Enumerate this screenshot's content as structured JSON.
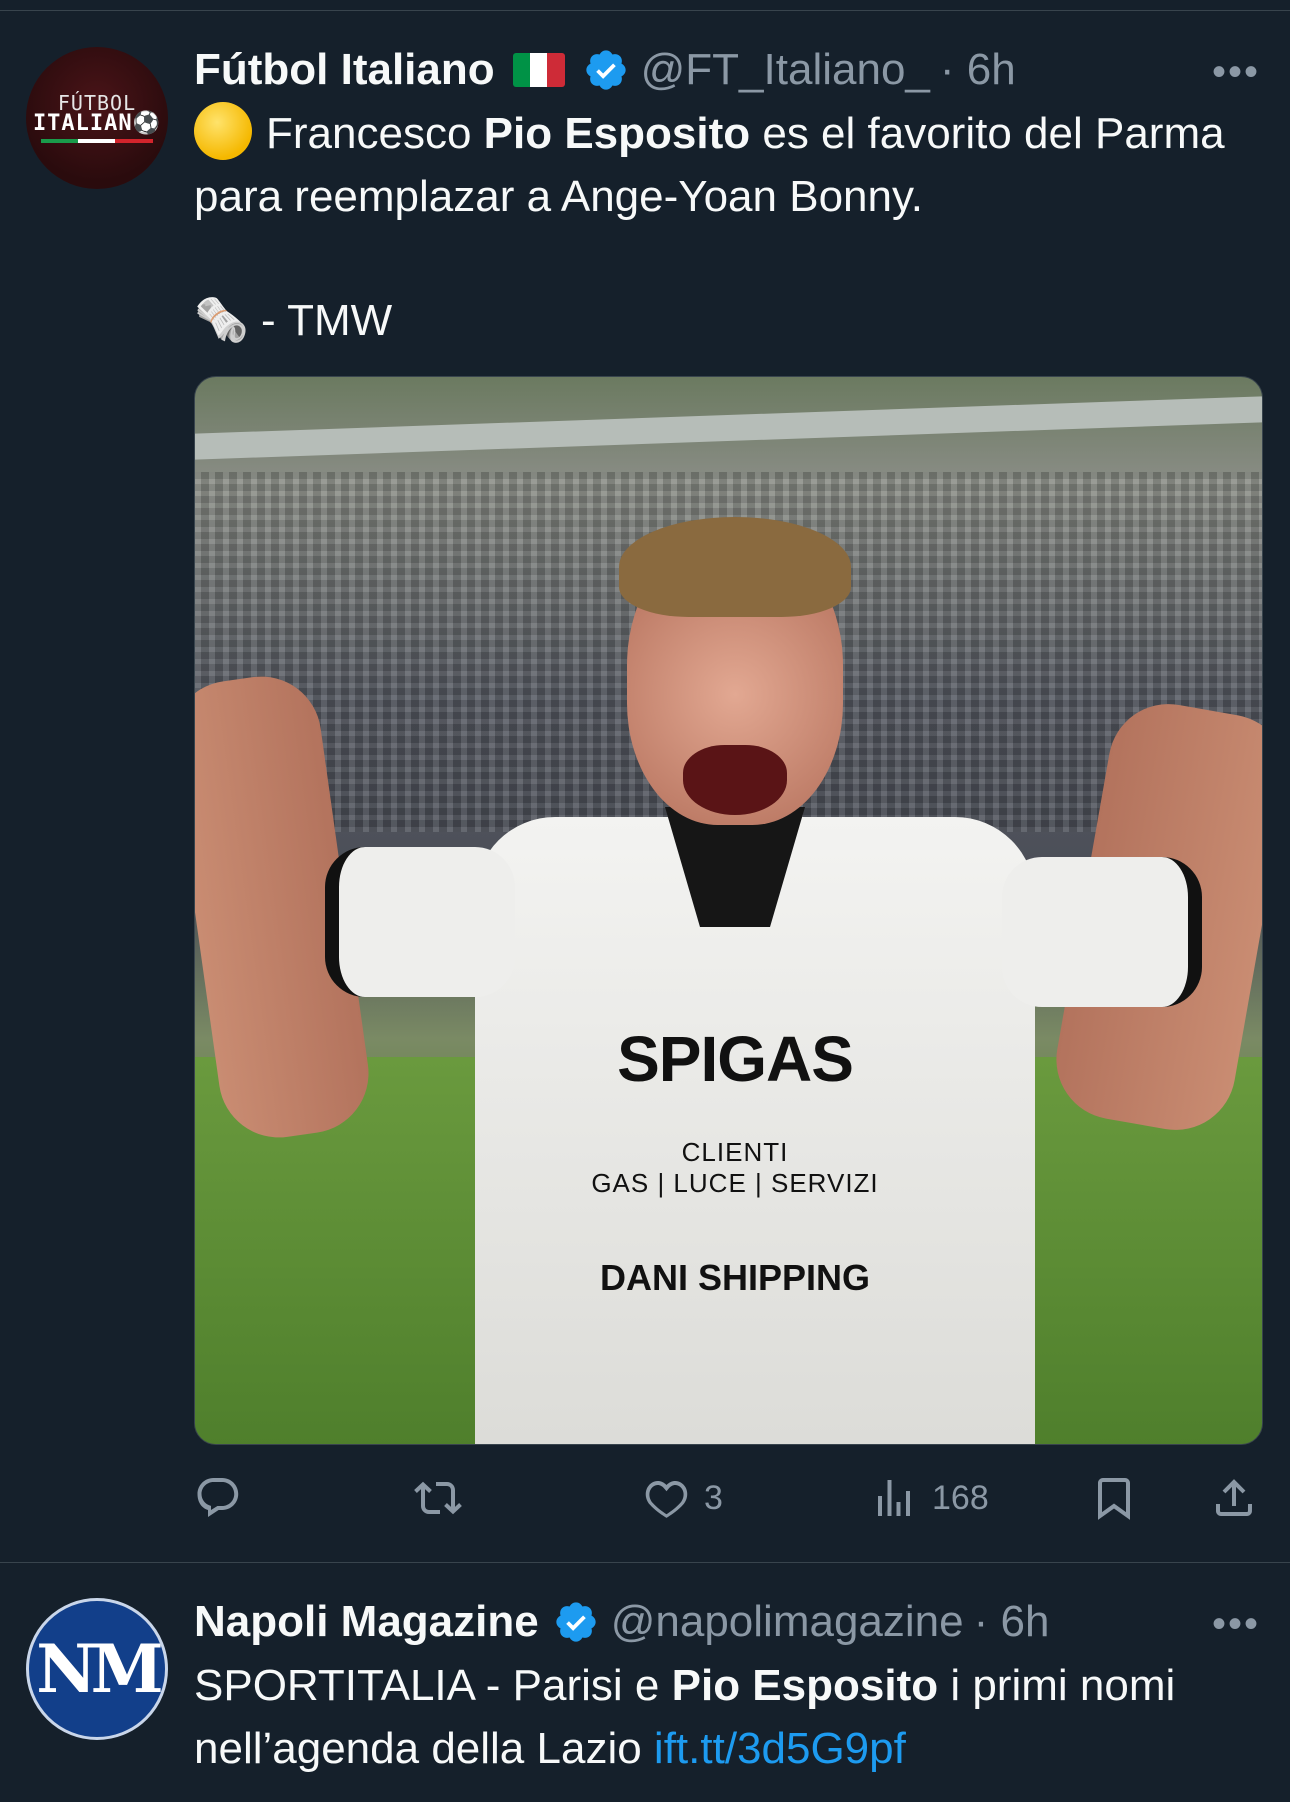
{
  "tweets": [
    {
      "avatar": {
        "line1": "FÚTBOL",
        "line2": "ITALIAN⚽"
      },
      "name": "Fútbol Italiano",
      "flag_colors": [
        "#009246",
        "#ffffff",
        "#ce2b37"
      ],
      "handle": "@FT_Italiano_",
      "time": "· 6h",
      "text": {
        "emoji": "yellow-circle",
        "part1": "Francesco ",
        "bold1": "Pio Esposito",
        "part2": " es el favorito del Parma para reemplazar a Ange-Yoan Bonny.",
        "source_icon": "🗞️",
        "source_text": " - TMW"
      },
      "media": {
        "sponsor_main": "SPIGAS",
        "sponsor_sub": "CLIENTI",
        "sponsor_services": "GAS | LUCE | SERVIZI",
        "sponsor_second": "DANI SHIPPING"
      },
      "actions": {
        "reply": "",
        "retweet": "",
        "like": "3",
        "views": "168"
      }
    },
    {
      "avatar": {
        "text": "NM"
      },
      "name": "Napoli Magazine",
      "handle": "@napolimagazine",
      "time": "· 6h",
      "text": {
        "part1": "SPORTITALIA - Parisi e ",
        "bold1": "Pio Esposito",
        "part2": " i primi nomi nell’agenda della Lazio ",
        "link": "ift.tt/3d5G9pf"
      }
    }
  ],
  "colors": {
    "background": "#15202b",
    "text": "#f7f9f9",
    "muted": "#8b98a5",
    "accent": "#1d9bf0",
    "divider": "#38444d"
  },
  "icons": [
    "more-icon",
    "verified-icon",
    "reply-icon",
    "retweet-icon",
    "like-icon",
    "views-icon",
    "bookmark-icon",
    "share-icon"
  ]
}
